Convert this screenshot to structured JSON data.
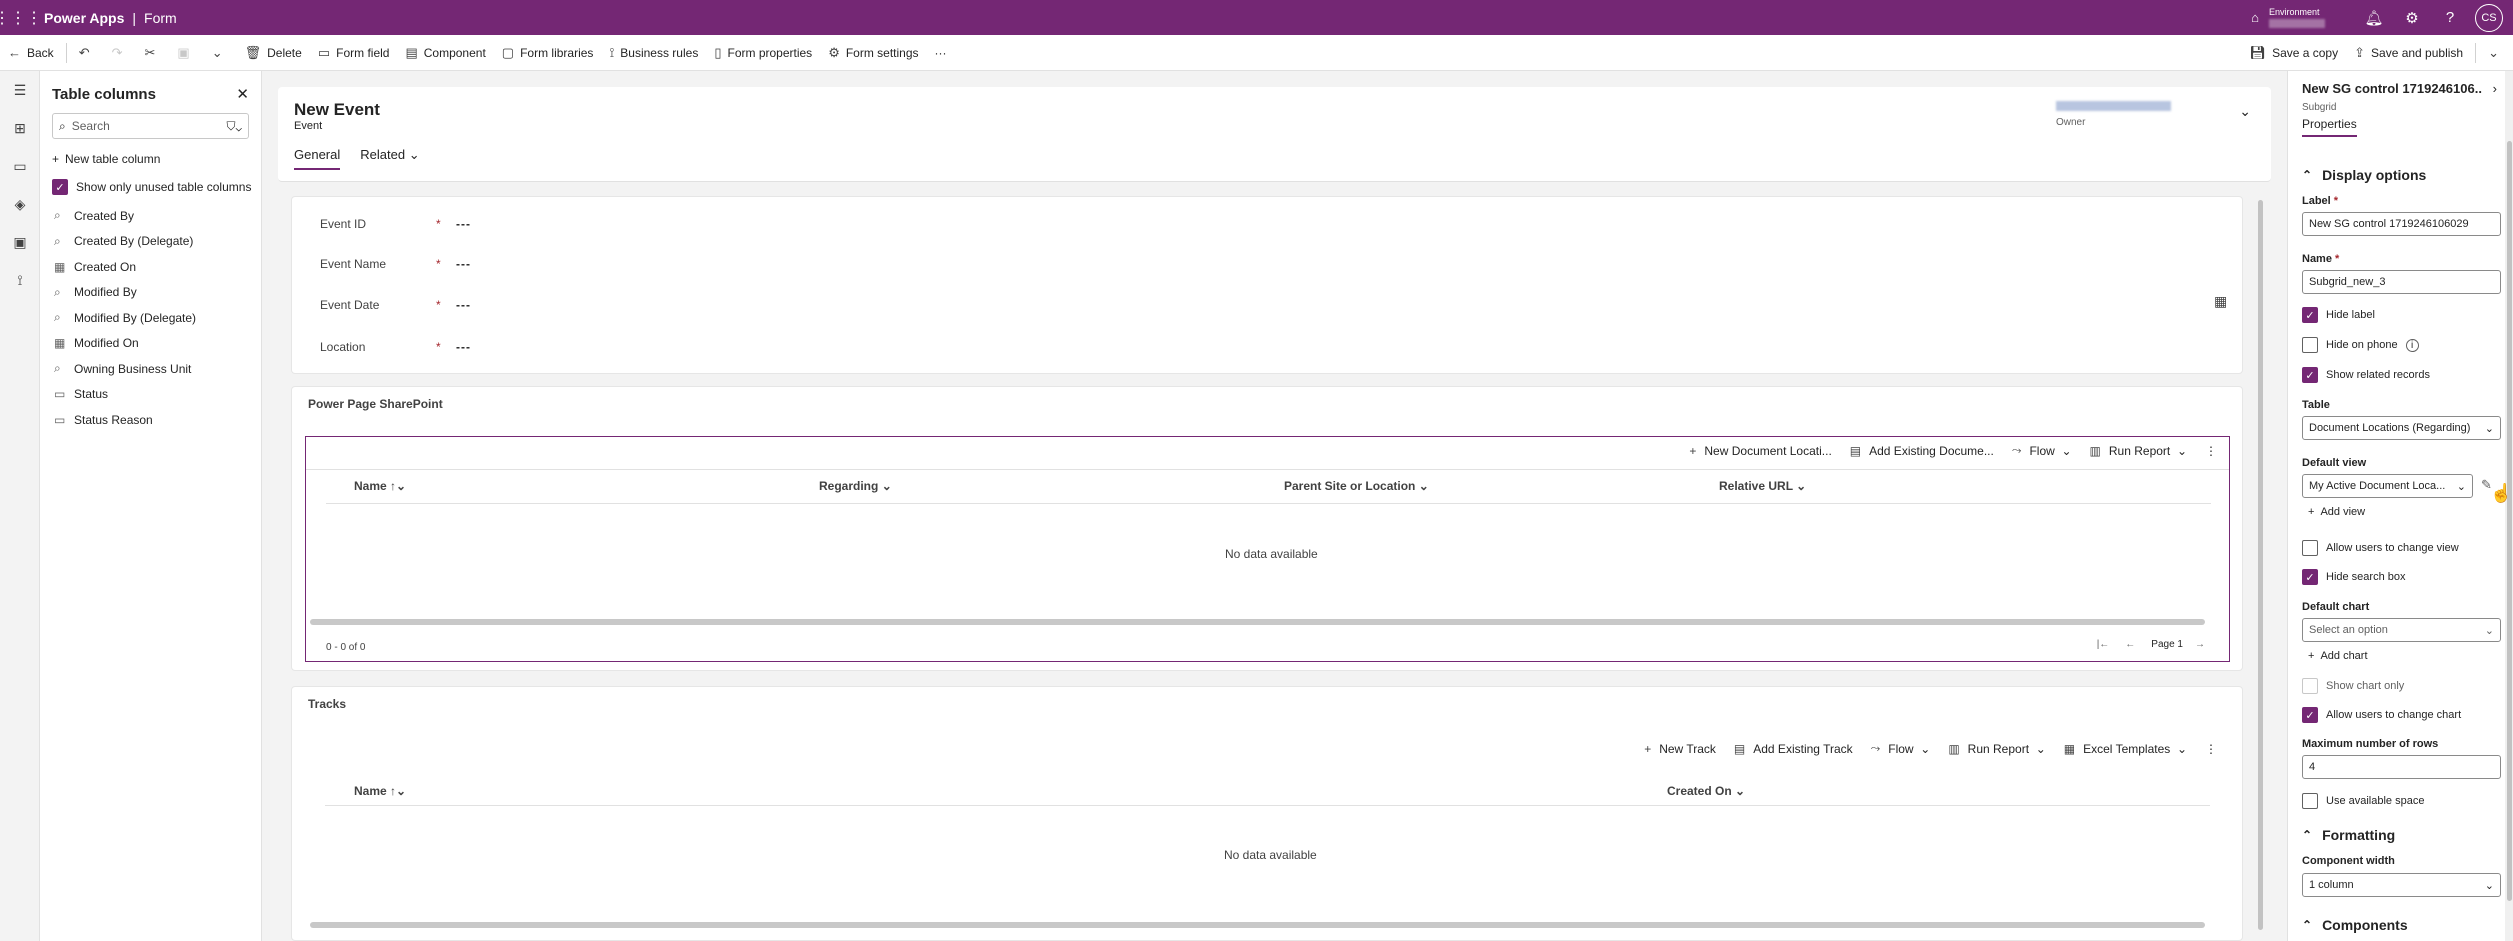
{
  "topbar": {
    "app_name": "Power Apps",
    "separator": "|",
    "page_name": "Form",
    "environment_label": "Environment",
    "avatar_initials": "CS"
  },
  "commandbar": {
    "back": "Back",
    "delete": "Delete",
    "form_field": "Form field",
    "component": "Component",
    "form_libraries": "Form libraries",
    "business_rules": "Business rules",
    "form_properties": "Form properties",
    "form_settings": "Form settings",
    "more": "···",
    "save_copy": "Save a copy",
    "save_publish": "Save and publish"
  },
  "columns_panel": {
    "title": "Table columns",
    "search_placeholder": "Search",
    "new_column": "New table column",
    "show_unused": "Show only unused table columns",
    "fields": [
      {
        "label": "Created By",
        "icon": "lookup-icon"
      },
      {
        "label": "Created By (Delegate)",
        "icon": "lookup-icon"
      },
      {
        "label": "Created On",
        "icon": "datetime-icon"
      },
      {
        "label": "Modified By",
        "icon": "lookup-icon"
      },
      {
        "label": "Modified By (Delegate)",
        "icon": "lookup-icon"
      },
      {
        "label": "Modified On",
        "icon": "datetime-icon"
      },
      {
        "label": "Owning Business Unit",
        "icon": "lookup-icon"
      },
      {
        "label": "Status",
        "icon": "optionset-icon"
      },
      {
        "label": "Status Reason",
        "icon": "optionset-icon"
      }
    ]
  },
  "form_header": {
    "title": "New Event",
    "subtitle": "Event",
    "owner_label": "Owner",
    "tab_general": "General",
    "tab_related": "Related"
  },
  "general_section": {
    "fields": [
      {
        "label": "Event ID",
        "value": "---"
      },
      {
        "label": "Event Name",
        "value": "---"
      },
      {
        "label": "Event Date",
        "value": "---"
      },
      {
        "label": "Location",
        "value": "---"
      }
    ],
    "required_marker": "*"
  },
  "sharepoint_section": {
    "title": "Power Page SharePoint",
    "toolbar": {
      "new_doc": "New Document Locati...",
      "add_existing": "Add Existing Docume...",
      "flow": "Flow",
      "run_report": "Run Report"
    },
    "columns": [
      "Name",
      "Regarding",
      "Parent Site or Location",
      "Relative URL"
    ],
    "empty": "No data available",
    "record_count": "0 - 0 of 0",
    "page": "Page 1"
  },
  "tracks_section": {
    "title": "Tracks",
    "toolbar": {
      "new_track": "New Track",
      "add_existing": "Add Existing Track",
      "flow": "Flow",
      "run_report": "Run Report",
      "excel": "Excel Templates"
    },
    "columns": [
      "Name",
      "Created On"
    ],
    "empty": "No data available"
  },
  "properties": {
    "title": "New SG control 1719246106...",
    "subtitle": "Subgrid",
    "tab": "Properties",
    "display_options": "Display options",
    "label_label": "Label",
    "label_value": "New SG control 1719246106029",
    "name_label": "Name",
    "name_value": "Subgrid_new_3",
    "hide_label": "Hide label",
    "hide_on_phone": "Hide on phone",
    "show_related": "Show related records",
    "table_label": "Table",
    "table_value": "Document Locations (Regarding)",
    "default_view_label": "Default view",
    "default_view_value": "My Active Document Loca...",
    "add_view": "Add view",
    "allow_change_view": "Allow users to change view",
    "hide_search": "Hide search box",
    "default_chart_label": "Default chart",
    "default_chart_value": "Select an option",
    "add_chart": "Add chart",
    "show_chart_only": "Show chart only",
    "allow_change_chart": "Allow users to change chart",
    "max_rows_label": "Maximum number of rows",
    "max_rows_value": "4",
    "use_space": "Use available space",
    "formatting": "Formatting",
    "component_width_label": "Component width",
    "component_width_value": "1 column",
    "components": "Components",
    "required_marker": "*"
  },
  "colors": {
    "brand": "#742774",
    "required": "#a4262c"
  }
}
